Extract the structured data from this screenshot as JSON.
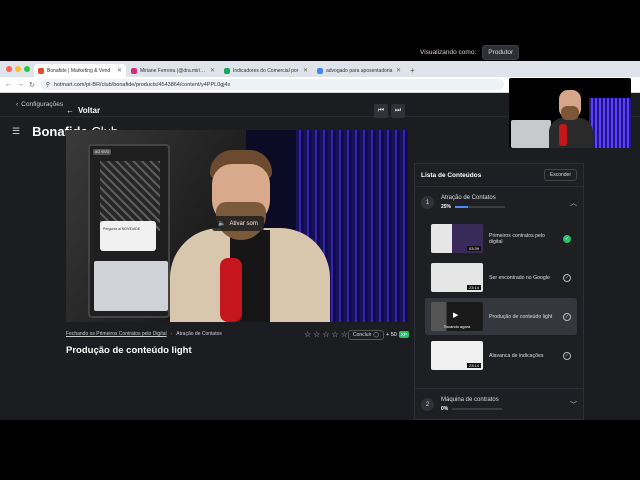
{
  "browser": {
    "tabs": [
      {
        "label": "Bonafide | Marketing & Vend",
        "favcolor": "#e04b2b",
        "active": true
      },
      {
        "label": "Miriane Ferreira (@dra.miriane",
        "favcolor": "#d62976",
        "active": false
      },
      {
        "label": "Indicadores do Comercial por",
        "favcolor": "#1ea362",
        "active": false
      },
      {
        "label": "advogado para aposentadoria",
        "favcolor": "#4285f4",
        "active": false
      }
    ],
    "url": "hotmart.com/pt-BR/club/bonafide/products/4543864/content/y4PPL0gj4x"
  },
  "page": {
    "config_label": "Configurações",
    "viz_label": "Visualizando como:",
    "viz_value": "Produtor",
    "logo_main": "Bonafide",
    "logo_sub": "Club",
    "back_label": "Voltar"
  },
  "video": {
    "activate_sound": "Ativar som",
    "phone_badge": "AO VIVO",
    "phone_popup": "Pergunta ai NOVIDADE"
  },
  "meta": {
    "crumb_link": "Fechando os Primeiros Contratos pelo Digital",
    "crumb_module": "Atração de Contatos",
    "concluir": "Concluir",
    "plus_label": "+ 50",
    "plus_chip": "XP",
    "lesson_title": "Produção de conteúdo light"
  },
  "sidebar": {
    "title": "Lista de Conteúdos",
    "hide_label": "Esconder",
    "modules": [
      {
        "num": "1",
        "name": "Atração de Contatos",
        "pct": "25%",
        "progress": 0.25
      },
      {
        "num": "2",
        "name": "Máquina de contratos",
        "pct": "0%",
        "progress": 0
      }
    ],
    "lessons": [
      {
        "title": "Primeiros contratos pelo digital",
        "duration": "03:39",
        "done": true,
        "current": false,
        "thumb": "#3a2a5a"
      },
      {
        "title": "Ser encontrado no Google",
        "duration": "23:14",
        "done": false,
        "current": false,
        "thumb": "#e6e6e6"
      },
      {
        "title": "Produção de conteúdo light",
        "duration": "",
        "done": false,
        "current": true,
        "thumb": "#222",
        "playing": "Tocando agora"
      },
      {
        "title": "Alavanca de indicações",
        "duration": "23:14",
        "done": false,
        "current": false,
        "thumb": "#f0f0f0"
      }
    ]
  }
}
